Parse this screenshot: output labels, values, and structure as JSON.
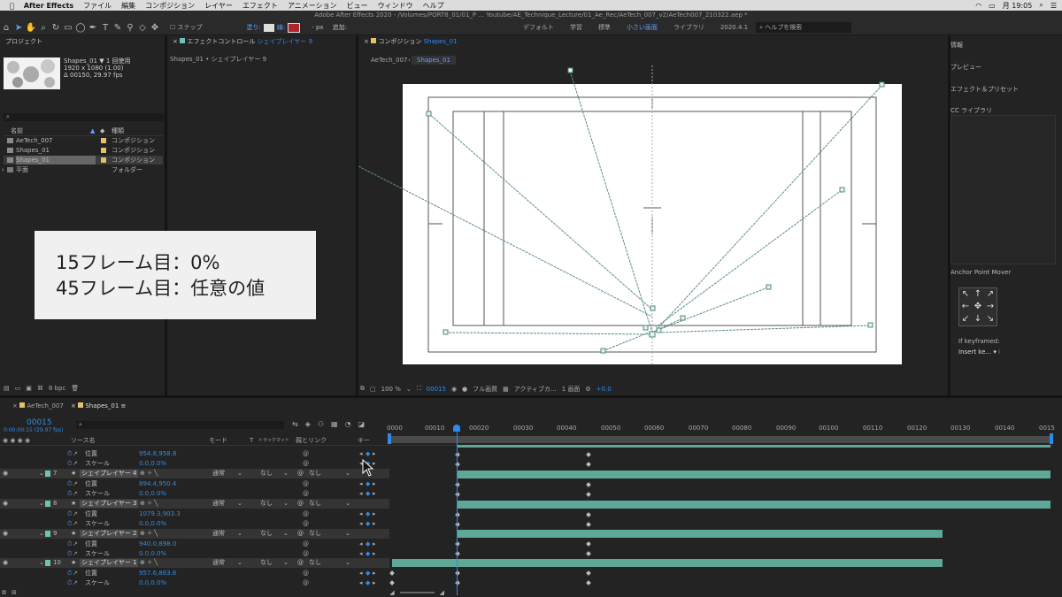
{
  "menubar": {
    "app": "After Effects",
    "items": [
      "ファイル",
      "編集",
      "コンポジション",
      "レイヤー",
      "エフェクト",
      "アニメーション",
      "ビュー",
      "ウィンドウ",
      "ヘルプ"
    ],
    "clock": "月 19:05"
  },
  "titlebar": "Adobe After Effects 2020 - /Volumes/PORT8_01/01_P ... Youtube/AE_Technique_Lecture/01_Ae_Rec/AeTech_007_v2/AeTech007_210322.aep *",
  "toolbar": {
    "snap": "スナップ",
    "fill_label": "塗り:",
    "stroke_label": "線:",
    "px_label": "- px",
    "add_label": "追加:",
    "workspaces": [
      "デフォルト",
      "学習",
      "標準",
      "小さい画面",
      "ライブラリ"
    ],
    "version": "2020.4.1",
    "search_placeholder": "ヘルプを検索"
  },
  "project": {
    "title": "プロジェクト",
    "selected_name": "Shapes_01 ▼",
    "usage": "1 回使用",
    "dims": "1920 x 1080 (1.00)",
    "duration": "Δ 00150, 29.97 fps",
    "col_name": "名前",
    "col_type": "種類",
    "items": [
      {
        "name": "AeTech_007",
        "type": "コンポジション"
      },
      {
        "name": "Shapes_01",
        "type": "コンポジション"
      },
      {
        "name": "Shapes_01",
        "type": "コンポジション"
      },
      {
        "name": "平面",
        "type": "フォルダー"
      }
    ],
    "bpc": "8 bpc"
  },
  "effects": {
    "title": "エフェクトコントロール",
    "layer": "シェイプレイヤー 9",
    "breadcrumb": "Shapes_01 • シェイプレイヤー 9"
  },
  "composition": {
    "title": "コンポジション",
    "comp_name": "Shapes_01",
    "tabs": [
      "AeTech_007",
      "Shapes_01"
    ],
    "zoom": "100 %",
    "frame": "00015",
    "quality": "フル画質",
    "camera": "アクティブカ...",
    "views": "1 画面",
    "exposure": "+0.0"
  },
  "right_panels": {
    "info": "情報",
    "preview": "プレビュー",
    "effects_presets": "エフェクト＆プリセット",
    "cc_libraries": "CC ライブラリ",
    "anchor_title": "Anchor Point Mover",
    "if_keyframed": "If keyframed:",
    "insert_ke": "Insert ke..."
  },
  "overlay": {
    "line1": "15フレーム目：0%",
    "line2": "45フレーム目：任意の値"
  },
  "timeline": {
    "tabs": [
      "AeTech_007",
      "Shapes_01"
    ],
    "timecode": "00015",
    "timecode_sub": "0:00:00:15 (29.97 fps)",
    "col_source": "ソース名",
    "col_mode": "モード",
    "col_t": "T",
    "col_track": "トラックマット",
    "col_parent": "親とリンク",
    "col_key": "キー",
    "ruler": [
      "0000",
      "00010",
      "00020",
      "00030",
      "00040",
      "00050",
      "00060",
      "00070",
      "00080",
      "00090",
      "00100",
      "00110",
      "00120",
      "00130",
      "00140",
      "0015"
    ],
    "mode_value": "通常",
    "none_value": "なし",
    "pos_label": "位置",
    "scale_label": "スケール",
    "rows": [
      {
        "kind": "prop",
        "name": "位置",
        "value": "954.8,958.8"
      },
      {
        "kind": "prop",
        "name": "スケール",
        "value": "0.0,0.0%"
      },
      {
        "kind": "layer",
        "num": "7",
        "name": "シェイプレイヤー 4"
      },
      {
        "kind": "prop",
        "name": "位置",
        "value": "894.4,950.4"
      },
      {
        "kind": "prop",
        "name": "スケール",
        "value": "0.0,0.0%"
      },
      {
        "kind": "layer",
        "num": "8",
        "name": "シェイプレイヤー 3"
      },
      {
        "kind": "prop",
        "name": "位置",
        "value": "1079.3,903.3"
      },
      {
        "kind": "prop",
        "name": "スケール",
        "value": "0.0,0.0%"
      },
      {
        "kind": "layer",
        "num": "9",
        "name": "シェイプレイヤー 2"
      },
      {
        "kind": "prop",
        "name": "位置",
        "value": "940.0,898.0"
      },
      {
        "kind": "prop",
        "name": "スケール",
        "value": "0.0,0.0%"
      },
      {
        "kind": "layer",
        "num": "10",
        "name": "シェイプレイヤー 1"
      },
      {
        "kind": "prop",
        "name": "位置",
        "value": "957.6,863.6"
      },
      {
        "kind": "prop",
        "name": "スケール",
        "value": "0.0,0.0%"
      }
    ]
  },
  "colors": {
    "accent": "#2d8ceb",
    "bar": "#5ea898",
    "layer_label": "#6fc2b5"
  }
}
